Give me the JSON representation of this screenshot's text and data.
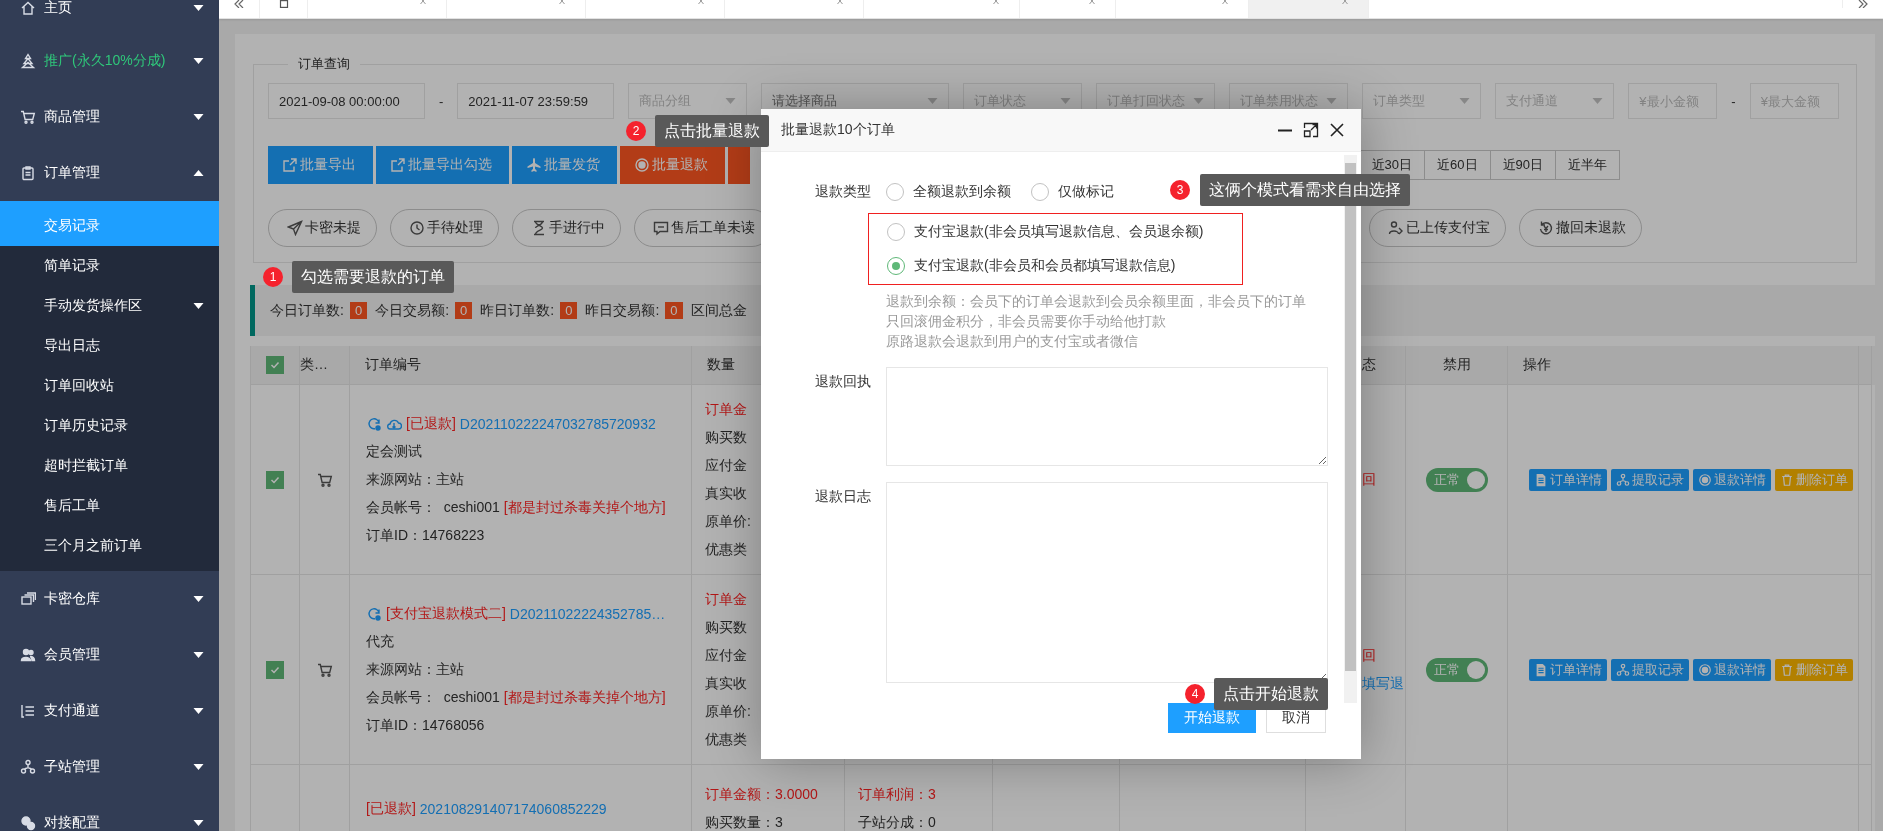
{
  "sidebar": {
    "items": [
      {
        "label": "主页",
        "expanded": false
      },
      {
        "label": "推广(永久10%分成)",
        "expanded": false,
        "color": "#2fc77a"
      },
      {
        "label": "商品管理",
        "expanded": false
      },
      {
        "label": "订单管理",
        "expanded": true,
        "children": [
          {
            "label": "交易记录",
            "selected": true
          },
          {
            "label": "简单记录",
            "selected": false
          },
          {
            "label": "手动发货操作区",
            "selected": false,
            "expanded": false
          },
          {
            "label": "导出日志",
            "selected": false
          },
          {
            "label": "订单回收站",
            "selected": false
          },
          {
            "label": "订单历史记录",
            "selected": false
          },
          {
            "label": "超时拦截订单",
            "selected": false
          },
          {
            "label": "售后工单",
            "selected": false
          },
          {
            "label": "三个月之前订单",
            "selected": false
          }
        ]
      },
      {
        "label": "卡密仓库",
        "expanded": false
      },
      {
        "label": "会员管理",
        "expanded": false
      },
      {
        "label": "支付通道",
        "expanded": false
      },
      {
        "label": "子站管理",
        "expanded": false
      },
      {
        "label": "对接配置",
        "expanded": false
      }
    ]
  },
  "tabs": [
    {
      "selected": false
    },
    {
      "selected": false
    },
    {
      "selected": false
    },
    {
      "selected": false
    },
    {
      "selected": false
    },
    {
      "selected": false
    },
    {
      "selected": false
    },
    {
      "selected": true
    }
  ],
  "filter": {
    "legend": "订单查询",
    "fields": [
      {
        "kind": "date",
        "value": "2021-09-08 00:00:00"
      },
      {
        "kind": "dash",
        "text": "-"
      },
      {
        "kind": "date",
        "value": "2021-11-07 23:59:59"
      },
      {
        "kind": "select",
        "placeholder": "商品分组"
      },
      {
        "kind": "multiselect",
        "placeholder": "请选择商品"
      },
      {
        "kind": "select",
        "placeholder": "订单状态"
      },
      {
        "kind": "select",
        "placeholder": "订单打回状态"
      },
      {
        "kind": "select",
        "placeholder": "订单禁用状态"
      },
      {
        "kind": "select",
        "placeholder": "订单类型"
      },
      {
        "kind": "select",
        "placeholder": "支付通道"
      },
      {
        "kind": "amount",
        "placeholder": "¥最小金额"
      },
      {
        "kind": "dash",
        "text": "-"
      },
      {
        "kind": "amount",
        "placeholder": "¥最大金额"
      }
    ],
    "actions": [
      {
        "label": "批量导出"
      },
      {
        "label": "批量导出勾选"
      },
      {
        "label": "批量发货"
      },
      {
        "label": "批量退款"
      },
      {
        "kind": "cut"
      }
    ],
    "quick_ranges": [
      "近30日",
      "近60日",
      "近90日",
      "近半年"
    ],
    "shortcuts_left": [
      "卡密未提",
      "手待处理",
      "手进行中",
      "售后工单未读"
    ],
    "shortcuts_right": [
      "已上传支付宝",
      "撤回未退款"
    ]
  },
  "stats": [
    {
      "label": "今日订单数:",
      "value": "0"
    },
    {
      "label": "今日交易额:",
      "value": "0"
    },
    {
      "label": "昨日订单数:",
      "value": "0"
    },
    {
      "label": "昨日交易额:",
      "value": "0"
    },
    {
      "label": "区间总金"
    }
  ],
  "table": {
    "header_checked": true,
    "columns": [
      "类…",
      "订单编号",
      "数量",
      "态",
      "禁用",
      "操作"
    ],
    "rows": [
      {
        "checked": true,
        "tag": "[已退款]",
        "order_no": "D202110222247032785720932",
        "product": "定会测试",
        "source": "来源网站：主站",
        "member": "会员帐号：  ceshi001",
        "member_note": "[都是封过杀毒关掉个地方]",
        "order_id": "订单ID：14768223",
        "quantity": [
          {
            "text": "订单金",
            "alert": true
          },
          {
            "text": "购买数",
            "alert": false
          },
          {
            "text": "应付金",
            "alert": false
          },
          {
            "text": "真实收",
            "alert": false
          },
          {
            "text": "原单价:",
            "alert": false
          },
          {
            "text": "优惠类",
            "alert": false
          }
        ],
        "status": [
          {
            "text": "回",
            "alert": true
          }
        ],
        "toggle": {
          "label": "正常",
          "on": true
        },
        "operations": [
          "订单详情",
          "提取记录",
          "退款详情",
          "删除订单"
        ]
      },
      {
        "checked": true,
        "tag": "[支付宝退款模式二]",
        "order_no": "D20211022224352785…",
        "product": "代充",
        "source": "来源网站：主站",
        "member": "会员帐号：  ceshi001",
        "member_note": "[都是封过杀毒关掉个地方]",
        "order_id": "订单ID：14768056",
        "quantity": [
          {
            "text": "订单金",
            "alert": true
          },
          {
            "text": "购买数",
            "alert": false
          },
          {
            "text": "应付金",
            "alert": false
          },
          {
            "text": "真实收",
            "alert": false
          },
          {
            "text": "原单价:",
            "alert": false
          },
          {
            "text": "优惠类",
            "alert": false
          }
        ],
        "status": [
          {
            "text": "回",
            "alert": true
          },
          {
            "text": "填写退",
            "alert": false
          }
        ],
        "toggle": {
          "label": "正常",
          "on": true
        },
        "operations": [
          "订单详情",
          "提取记录",
          "退款详情",
          "删除订单"
        ]
      },
      {
        "tag": "[已退款]",
        "order_no": "202108291407174060852229",
        "quantity": [
          {
            "text": "订单金额：3.0000",
            "alert": true
          },
          {
            "text": "购买数量：3",
            "alert": false
          }
        ],
        "profit": [
          {
            "text": "订单利润：3",
            "alert": true
          },
          {
            "text": "子站分成：0",
            "alert": false
          }
        ]
      }
    ]
  },
  "modal": {
    "title": "批量退款10个订单",
    "refund_type": {
      "label": "退款类型",
      "options": [
        {
          "label": "全额退款到余额",
          "selected": false
        },
        {
          "label": "仅做标记",
          "selected": false
        }
      ],
      "highlighted_options": [
        {
          "label": "支付宝退款(非会员填写退款信息、会员退余额)",
          "selected": false
        },
        {
          "label": "支付宝退款(非会员和会员都填写退款信息)",
          "selected": true
        }
      ]
    },
    "hint": [
      "退款到余额：会员下的订单会退款到会员余额里面，非会员下的订单",
      "只回滚佣金积分，非会员需要你手动给他打款",
      "原路退款会退款到用户的支付宝或者微信"
    ],
    "receipt": {
      "label": "退款回执"
    },
    "log": {
      "label": "退款日志"
    },
    "buttons": [
      "开始退款",
      "取消"
    ]
  },
  "annotations": [
    {
      "number": "1",
      "text": "勾选需要退款的订单"
    },
    {
      "number": "2",
      "text": "点击批量退款"
    },
    {
      "number": "3",
      "text": "这俩个模式看需求自由选择"
    },
    {
      "number": "4",
      "text": "点击开始退款"
    }
  ]
}
